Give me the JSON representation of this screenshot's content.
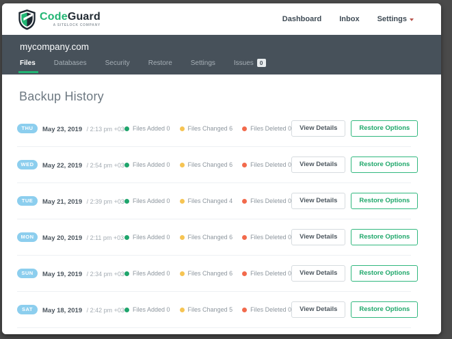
{
  "brand": {
    "name_primary": "Code",
    "name_secondary": "Guard",
    "tagline": "A SITELOCK COMPANY"
  },
  "colors": {
    "brand_green": "#21b573",
    "stat_added": "#1fa56c",
    "stat_changed": "#f6c453",
    "stat_deleted": "#f26a4c",
    "day_badge_blue": "#8cceee",
    "site_bar_slate": "#47515a"
  },
  "top_nav": {
    "items": [
      {
        "label": "Dashboard"
      },
      {
        "label": "Inbox"
      },
      {
        "label": "Settings"
      }
    ]
  },
  "site": {
    "domain": "mycompany.com"
  },
  "tabs": [
    {
      "label": "Files",
      "active": true
    },
    {
      "label": "Databases",
      "active": false
    },
    {
      "label": "Security",
      "active": false
    },
    {
      "label": "Restore",
      "active": false
    },
    {
      "label": "Settings",
      "active": false
    },
    {
      "label": "Issues",
      "active": false,
      "badge": "0"
    }
  ],
  "page": {
    "title": "Backup History"
  },
  "actions": {
    "view_details": "View Details",
    "restore_options": "Restore Options"
  },
  "backup_rows": [
    {
      "day": "THU",
      "date": "May 23, 2019",
      "time": "/ 2:13 pm +03",
      "stats": [
        {
          "key": "added",
          "label": "Files Added",
          "value": 0
        },
        {
          "key": "changed",
          "label": "Files Changed",
          "value": 6
        },
        {
          "key": "deleted",
          "label": "Files Deleted",
          "value": 0
        }
      ]
    },
    {
      "day": "WED",
      "date": "May 22, 2019",
      "time": "/ 2:54 pm +03",
      "stats": [
        {
          "key": "added",
          "label": "Files Added",
          "value": 0
        },
        {
          "key": "changed",
          "label": "Files Changed",
          "value": 6
        },
        {
          "key": "deleted",
          "label": "Files Deleted",
          "value": 0
        }
      ]
    },
    {
      "day": "TUE",
      "date": "May 21, 2019",
      "time": "/ 2:39 pm +03",
      "stats": [
        {
          "key": "added",
          "label": "Files Added",
          "value": 0
        },
        {
          "key": "changed",
          "label": "Files Changed",
          "value": 4
        },
        {
          "key": "deleted",
          "label": "Files Deleted",
          "value": 0
        }
      ]
    },
    {
      "day": "MON",
      "date": "May 20, 2019",
      "time": "/ 2:11 pm +03",
      "stats": [
        {
          "key": "added",
          "label": "Files Added",
          "value": 0
        },
        {
          "key": "changed",
          "label": "Files Changed",
          "value": 6
        },
        {
          "key": "deleted",
          "label": "Files Deleted",
          "value": 0
        }
      ]
    },
    {
      "day": "SUN",
      "date": "May 19, 2019",
      "time": "/ 2:34 pm +03",
      "stats": [
        {
          "key": "added",
          "label": "Files Added",
          "value": 0
        },
        {
          "key": "changed",
          "label": "Files Changed",
          "value": 6
        },
        {
          "key": "deleted",
          "label": "Files Deleted",
          "value": 0
        }
      ]
    },
    {
      "day": "SAT",
      "date": "May 18, 2019",
      "time": "/ 2:42 pm +03",
      "stats": [
        {
          "key": "added",
          "label": "Files Added",
          "value": 0
        },
        {
          "key": "changed",
          "label": "Files Changed",
          "value": 5
        },
        {
          "key": "deleted",
          "label": "Files Deleted",
          "value": 0
        }
      ]
    }
  ]
}
